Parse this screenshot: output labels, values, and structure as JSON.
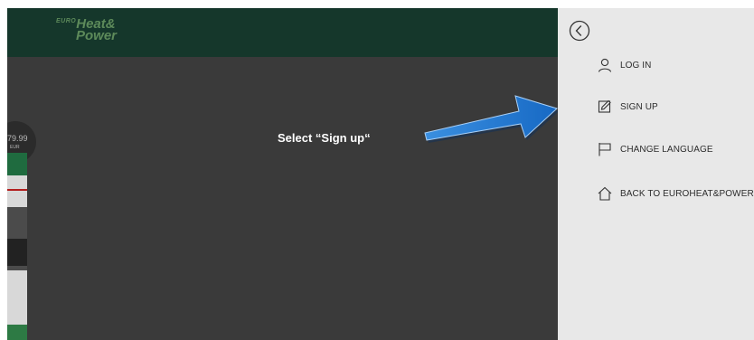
{
  "header": {
    "logo_euro": "EURO",
    "logo_heat": "Heat&",
    "logo_power": "Power"
  },
  "background_product": {
    "price": "79.99",
    "currency": "EUR"
  },
  "tutorial": {
    "instruction": "Select “Sign up“",
    "arrow_color": "#1e7fd8"
  },
  "side_menu": {
    "back_icon": "chevron-left-circle-icon",
    "items": [
      {
        "label": "LOG IN",
        "icon": "user-icon"
      },
      {
        "label": "SIGN UP",
        "icon": "edit-icon"
      },
      {
        "label": "CHANGE LANGUAGE",
        "icon": "flag-icon"
      },
      {
        "label": "BACK TO EUROHEAT&POWER",
        "icon": "home-icon"
      }
    ]
  },
  "colors": {
    "header_bg": "#15372b",
    "overlay_bg": "#3a3a3a",
    "panel_bg": "#e8e8e8",
    "logo": "#5d8a5a"
  }
}
